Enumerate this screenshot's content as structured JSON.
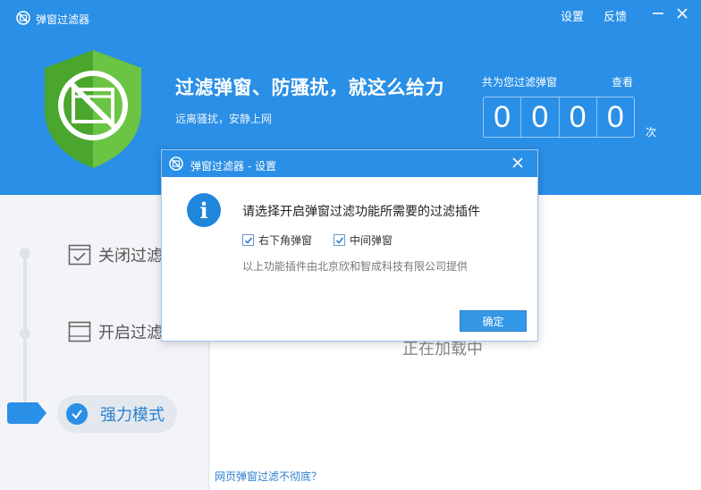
{
  "app": {
    "title": "弹窗过滤器"
  },
  "topbar": {
    "settings": "设置",
    "feedback": "反馈"
  },
  "hero": {
    "headline": "过滤弹窗、防骚扰，就这么给力",
    "subline": "远离骚扰，安静上网"
  },
  "counter": {
    "label": "共为您过滤弹窗",
    "view": "查看",
    "digits": [
      "0",
      "0",
      "0",
      "0"
    ],
    "unit": "次"
  },
  "modes": [
    {
      "label": "关闭过滤"
    },
    {
      "label": "开启过滤"
    },
    {
      "label": "强力模式",
      "active": true
    }
  ],
  "main": {
    "loading": "正在加载中",
    "bottom_link": "网页弹窗过滤不彻底？"
  },
  "dialog": {
    "title": "弹窗过滤器 - 设置",
    "question": "请选择开启弹窗过滤功能所需要的过滤插件",
    "options": [
      {
        "label": "右下角弹窗",
        "checked": true
      },
      {
        "label": "中间弹窗",
        "checked": true
      }
    ],
    "note": "以上功能插件由北京欣和智成科技有限公司提供",
    "ok": "确定"
  },
  "colors": {
    "primary": "#2a8fe6",
    "shield_green": "#5cb83a"
  },
  "icons": [
    "app-logo-icon",
    "minimize-icon",
    "close-icon",
    "shield-icon",
    "disable-window-icon",
    "enable-window-icon",
    "check-icon",
    "info-icon"
  ]
}
